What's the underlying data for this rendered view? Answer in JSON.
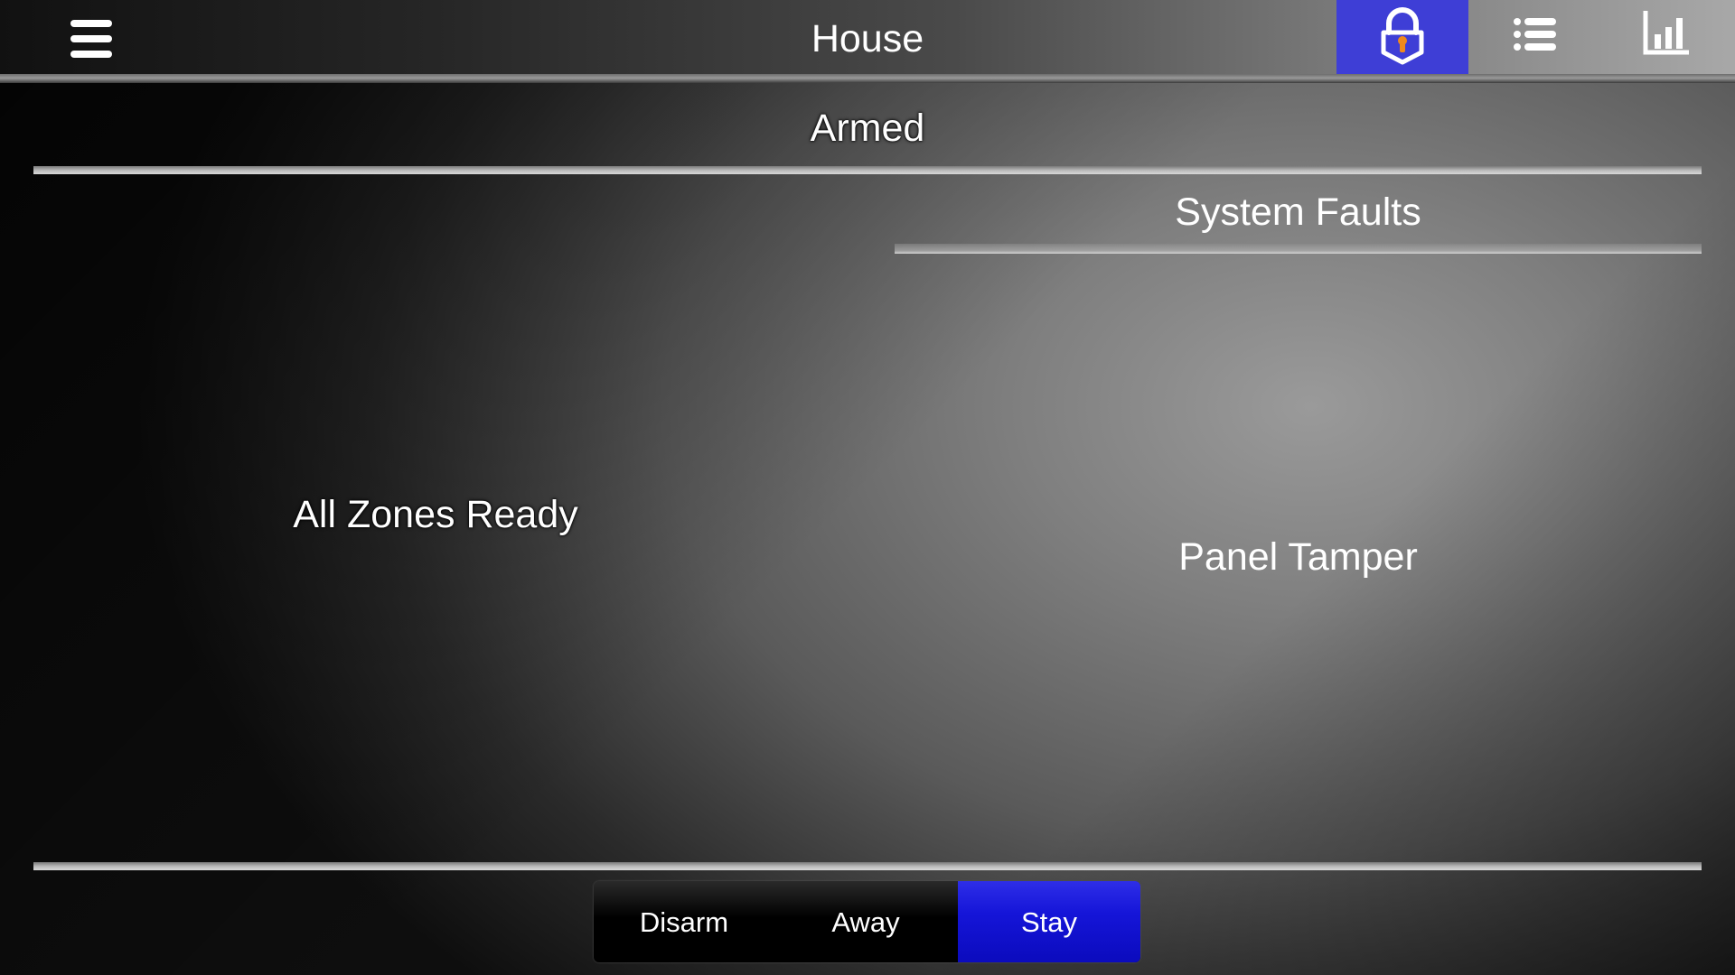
{
  "header": {
    "title": "House",
    "menu_icon": "hamburger-menu-icon",
    "tabs": [
      {
        "name": "security",
        "icon": "padlock-icon",
        "active": true
      },
      {
        "name": "zones-list",
        "icon": "list-icon",
        "active": false
      },
      {
        "name": "history",
        "icon": "bar-chart-icon",
        "active": false
      }
    ]
  },
  "status": {
    "arm_state": "Armed"
  },
  "zones": {
    "status_text": "All Zones Ready"
  },
  "faults": {
    "title": "System Faults",
    "items": [
      "Panel Tamper"
    ]
  },
  "arm_controls": {
    "disarm_label": "Disarm",
    "away_label": "Away",
    "stay_label": "Stay",
    "selected": "Stay"
  },
  "colors": {
    "accent_blue": "#3e3ed6",
    "stay_blue": "#1515d8",
    "lock_keyhole": "#f08a1c"
  }
}
